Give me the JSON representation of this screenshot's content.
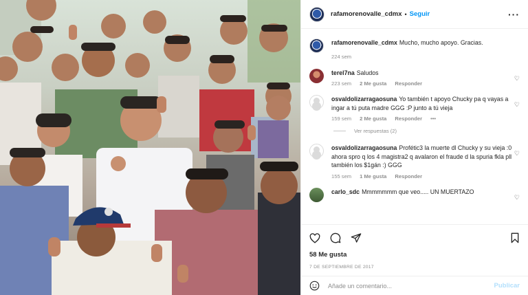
{
  "post": {
    "username": "rafamorenovalle_cdmx",
    "follow_label": "Seguir",
    "more_label": "···",
    "caption": {
      "username": "rafamorenovalle_cdmx",
      "text": "Mucho, mucho apoyo. Gracias.",
      "time": "224 sem"
    }
  },
  "comments": [
    {
      "username": "terel7na",
      "text": "Saludos",
      "time": "223 sem",
      "likes": "2 Me gusta",
      "reply": "Responder",
      "more": ""
    },
    {
      "username": "osvaldolizarragaosuna",
      "text": "Yo también t apoyo Chucky pa q vayas a ingar a tú puta madre GGG :P junto a tú vieja",
      "time": "159 sem",
      "likes": "2 Me gusta",
      "reply": "Responder",
      "more": "•••",
      "view_replies": "Ver respuestas (2)"
    },
    {
      "username": "osvaldolizarragaosuna",
      "text": "Profétic3 la muerte dl Chucky y su vieja :0 ahora spro q los 4 magistra2 q avalaron el fraude d la spuria fkla pll también los $1gán :) GGG",
      "time": "155 sem",
      "likes": "1 Me gusta",
      "reply": "Responder",
      "more": ""
    },
    {
      "username": "carlo_sdc",
      "text": "Mmmmmmm que veo..... UN MUERTAZO",
      "time": "",
      "likes": "",
      "reply": "",
      "more": ""
    }
  ],
  "actions": {
    "likes": "58 Me gusta",
    "date": "7 DE SEPTIEMBRE DE 2017"
  },
  "add_comment": {
    "placeholder": "Añade un comentario...",
    "post_label": "Publicar"
  },
  "colors": {
    "link": "#0095f6",
    "muted": "#8e8e8e",
    "post_disabled": "#b2dffc"
  }
}
